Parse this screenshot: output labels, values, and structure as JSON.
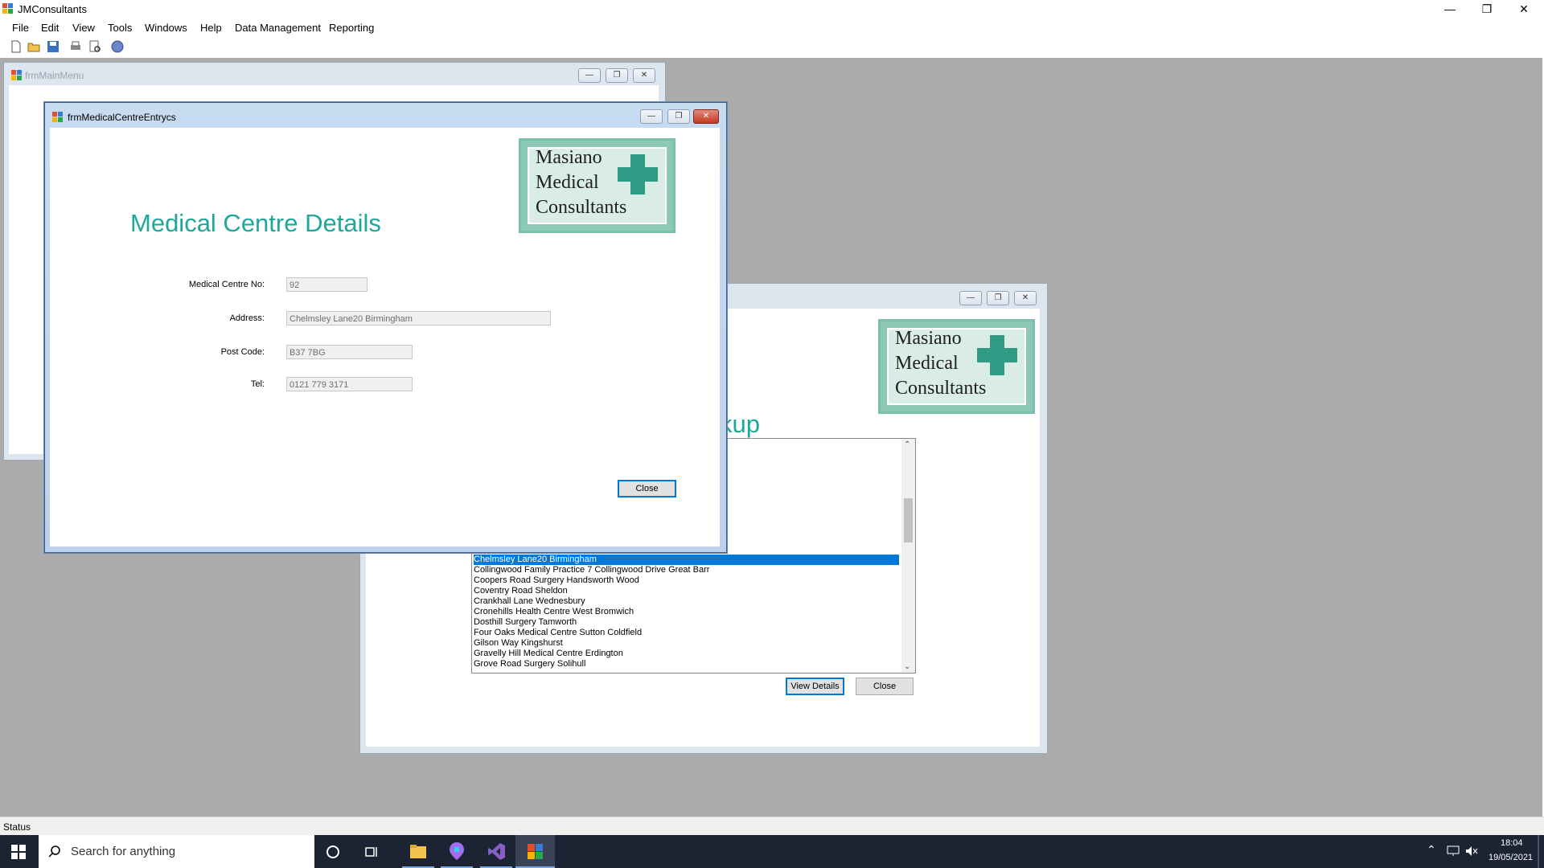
{
  "app": {
    "title": "JMConsultants",
    "menu": [
      "File",
      "Edit",
      "View",
      "Tools",
      "Windows",
      "Help",
      "Data Management",
      "Reporting"
    ],
    "caption_minimize": "—",
    "caption_restore": "❐",
    "caption_close": "✕"
  },
  "main_menu_window": {
    "title": "frmMainMenu"
  },
  "lookup_window": {
    "heading_fragment": "kup",
    "logo": {
      "line1": "Masiano",
      "line2": "Medical",
      "line3": "Consultants"
    },
    "list_items": [
      "Chelmsley Lane20 Birmingham",
      "Collingwood Family Practice 7 Collingwood Drive Great Barr",
      "Coopers Road Surgery Handsworth Wood",
      "Coventry Road Sheldon",
      "Crankhall Lane Wednesbury",
      "Cronehills Health Centre West Bromwich",
      "Dosthill Surgery Tamworth",
      "Four Oaks Medical Centre Sutton Coldfield",
      "Gilson Way Kingshurst",
      "Gravelly Hill Medical Centre Erdington",
      "Grove Road Surgery Solihull"
    ],
    "selected_index": 0,
    "view_details_label": "View Details",
    "close_label": "Close"
  },
  "entry_window": {
    "title": "frmMedicalCentreEntrycs",
    "heading": "Medical Centre Details",
    "logo": {
      "line1": "Masiano",
      "line2": "Medical",
      "line3": "Consultants"
    },
    "fields": {
      "centre_no_label": "Medical Centre No:",
      "centre_no_value": "92",
      "address_label": "Address:",
      "address_value": "Chelmsley Lane20 Birmingham",
      "postcode_label": "Post Code:",
      "postcode_value": "B37 7BG",
      "tel_label": "Tel:",
      "tel_value": "0121 779 3171"
    },
    "close_label": "Close"
  },
  "status": {
    "text": "Status"
  },
  "taskbar": {
    "search_placeholder": "Search for anything",
    "time": "18:04",
    "date": "19/05/2021"
  },
  "colors": {
    "heading": "#1fa79a",
    "selection": "#0078d7",
    "taskbar": "#1c2434"
  }
}
